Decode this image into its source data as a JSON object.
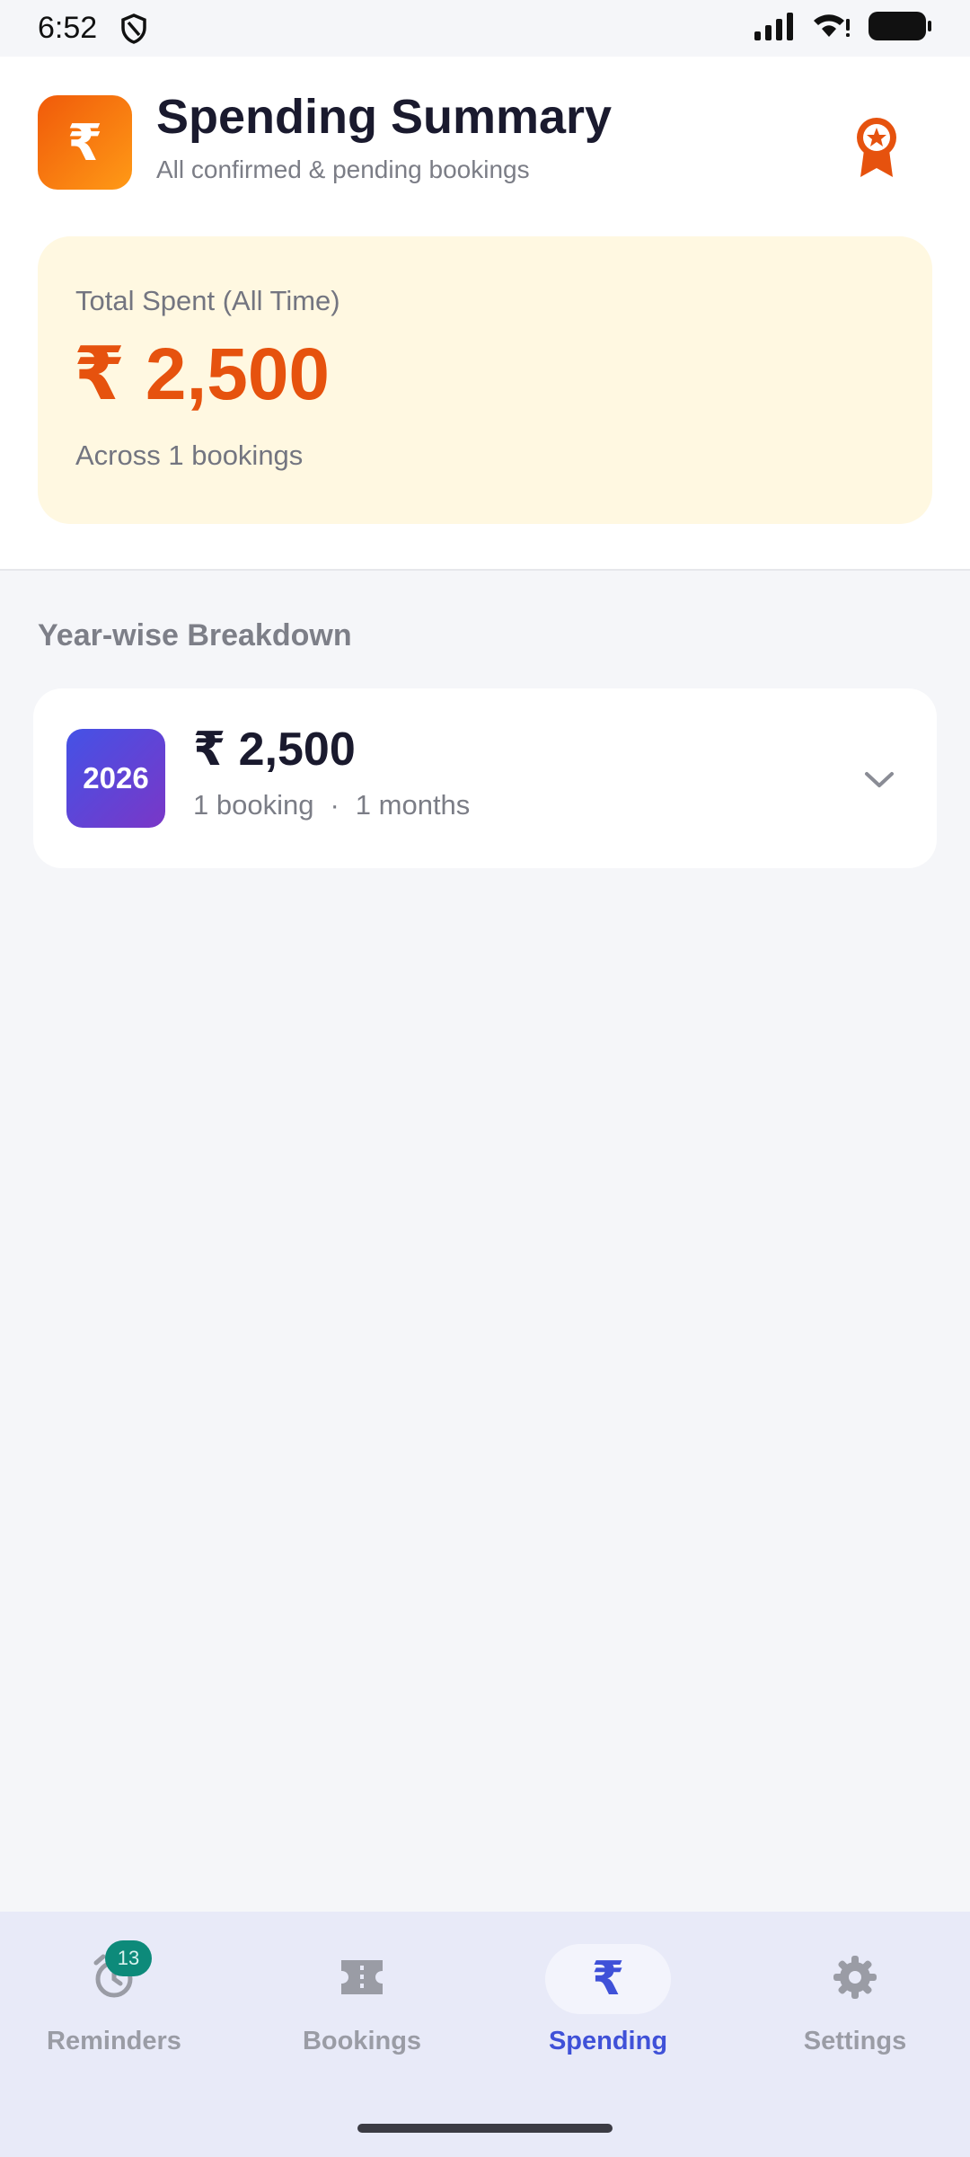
{
  "status_bar": {
    "time": "6:52"
  },
  "header": {
    "logo_symbol": "₹",
    "title": "Spending Summary",
    "subtitle": "All confirmed & pending bookings",
    "award_icon": "award-ribbon-icon"
  },
  "total_card": {
    "label": "Total Spent (All Time)",
    "amount": "₹ 2,500",
    "subtitle": "Across 1 bookings"
  },
  "breakdown": {
    "section_title": "Year-wise Breakdown",
    "years": [
      {
        "year": "2026",
        "amount": "₹ 2,500",
        "bookings": "1 booking",
        "separator": "·",
        "months": "1 months"
      }
    ]
  },
  "nav": {
    "items": [
      {
        "label": "Reminders",
        "icon": "alarm-icon",
        "badge": "13",
        "active": false
      },
      {
        "label": "Bookings",
        "icon": "ticket-icon",
        "active": false
      },
      {
        "label": "Spending",
        "icon": "rupee-icon",
        "glyph": "₹",
        "active": true
      },
      {
        "label": "Settings",
        "icon": "gear-icon",
        "active": false
      }
    ]
  },
  "colors": {
    "accent_orange": "#e6520e",
    "nav_active": "#3f51d8",
    "card_background": "#fff8e1",
    "year_badge": "#5a44d8",
    "badge": "#0d8a7a"
  }
}
